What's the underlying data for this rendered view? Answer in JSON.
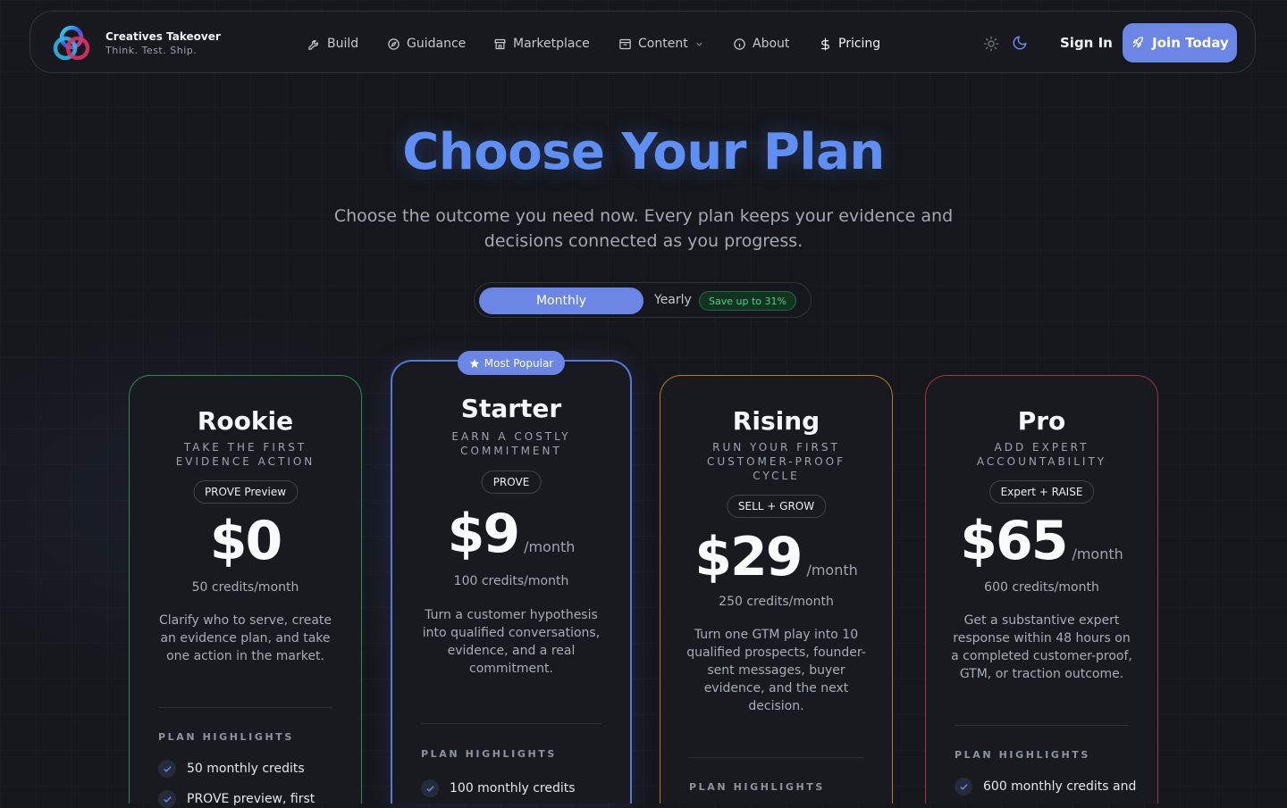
{
  "brand": {
    "name": "Creatives Takeover",
    "tagline": "Think. Test. Ship."
  },
  "nav": {
    "items": [
      {
        "label": "Build",
        "icon": "wrench-icon"
      },
      {
        "label": "Guidance",
        "icon": "compass-icon"
      },
      {
        "label": "Marketplace",
        "icon": "store-icon"
      },
      {
        "label": "Content",
        "icon": "archive-icon"
      },
      {
        "label": "About",
        "icon": "info-icon"
      },
      {
        "label": "Pricing",
        "icon": "dollar-icon"
      }
    ],
    "sign_in": "Sign In",
    "join": "Join Today"
  },
  "hero": {
    "title": "Choose Your Plan",
    "subtitle": "Choose the outcome you need now. Every plan keeps your evidence and decisions connected as you progress."
  },
  "billing": {
    "monthly": "Monthly",
    "yearly": "Yearly",
    "save": "Save up to 31%"
  },
  "popular_label": "Most Popular",
  "highlights_heading": "PLAN HIGHLIGHTS",
  "colors": {
    "accent": "#6c86e6",
    "rookie": "#2f8a52",
    "starter": "#5a76d8",
    "rising": "#b07a2e",
    "pro": "#9a3a3a",
    "title": "#5f8ff2"
  },
  "plans": [
    {
      "name": "Rookie",
      "tagline": "TAKE THE FIRST EVIDENCE ACTION",
      "badge": "PROVE Preview",
      "price": "$0",
      "period": "",
      "credits": "50 credits/month",
      "description": "Clarify who to serve, create an evidence plan, and take one action in the market.",
      "features": [
        "50 monthly credits",
        "PROVE preview, first"
      ]
    },
    {
      "name": "Starter",
      "tagline": "EARN A COSTLY COMMITMENT",
      "badge": "PROVE",
      "price": "$9",
      "period": "/month",
      "credits": "100 credits/month",
      "description": "Turn a customer hypothesis into qualified conversations, evidence, and a real commitment.",
      "features": [
        "100 monthly credits"
      ]
    },
    {
      "name": "Rising",
      "tagline": "RUN YOUR FIRST CUSTOMER-PROOF CYCLE",
      "badge": "SELL + GROW",
      "price": "$29",
      "period": "/month",
      "credits": "250 credits/month",
      "description": "Turn one GTM play into 10 qualified prospects, founder-sent messages, buyer evidence, and the next decision.",
      "features": []
    },
    {
      "name": "Pro",
      "tagline": "ADD EXPERT ACCOUNTABILITY",
      "badge": "Expert + RAISE",
      "price": "$65",
      "period": "/month",
      "credits": "600 credits/month",
      "description": "Get a substantive expert response within 48 hours on a completed customer-proof, GTM, or traction outcome.",
      "features": [
        "600 monthly credits and"
      ]
    }
  ]
}
